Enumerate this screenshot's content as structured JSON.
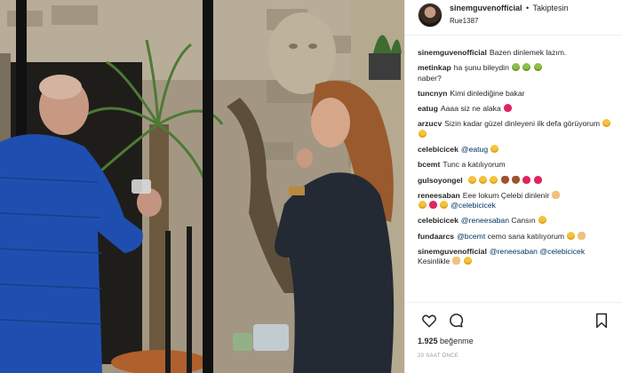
{
  "post": {
    "username": "sinemguvenofficial",
    "separator": "•",
    "follow_label": "Takiptesin",
    "location": "Rue1387",
    "likes_count": "1.925",
    "likes_label": "beğenme",
    "timestamp": "20 SAAT ÖNCE"
  },
  "comments": [
    {
      "user": "sinemguvenofficial",
      "text": "Bazen dinlemek lazım.",
      "emoji": []
    },
    {
      "user": "metinkap",
      "text": "ha şunu bileydin",
      "emoji": [
        "g",
        "g",
        "g"
      ],
      "tail": "naber?"
    },
    {
      "user": "tuncnyn",
      "text": "Kimi dinlediğine bakar",
      "emoji": []
    },
    {
      "user": "eatug",
      "text": "Aaaa siz ne alaka",
      "emoji": [
        "r"
      ]
    },
    {
      "user": "arzucv",
      "text": "Sizin kadar güzel dinleyeni ilk defa görüyorum",
      "emoji": [
        "y",
        "y"
      ]
    },
    {
      "user": "celebicicek",
      "mention": "@eatug",
      "text": "",
      "emoji": [
        "y"
      ]
    },
    {
      "user": "bcemt",
      "text": "Tunc a katılıyorum",
      "emoji": []
    },
    {
      "user": "gulsoyongel",
      "text": "",
      "emoji": [
        "y",
        "y",
        "y",
        "br",
        "br",
        "r",
        "r"
      ]
    },
    {
      "user": "reneesaban",
      "text": "Eee lokum Çelebi dinlenir",
      "emoji": [
        "hand",
        "y",
        "r",
        "y"
      ],
      "mention": "@celebicicek"
    },
    {
      "user": "celebicicek",
      "text": "Cansın",
      "mention": "@reneesaban",
      "emoji": [
        "y"
      ]
    },
    {
      "user": "fundaarcs",
      "mention": "@bcemt",
      "text": "cemo sana katılıyorum",
      "emoji": [
        "y",
        "hand"
      ]
    },
    {
      "user": "sinemguvenofficial",
      "mention": "@reneesaban",
      "mention2": "@celebicicek",
      "text": "Kesinlikle",
      "emoji": [
        "hand",
        "y"
      ]
    }
  ],
  "icons": {
    "heart": "heart-icon",
    "comment": "comment-icon",
    "bookmark": "bookmark-icon"
  }
}
